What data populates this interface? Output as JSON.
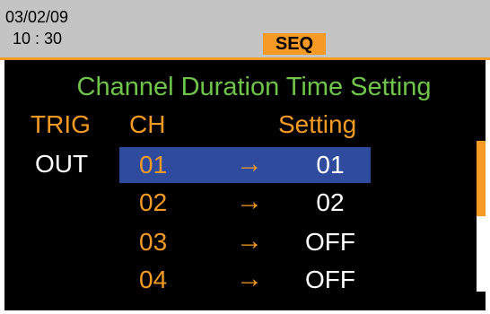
{
  "status": {
    "date": "03/02/09",
    "time": "10 : 30",
    "mode": "SEQ"
  },
  "panel": {
    "title": "Channel Duration Time Setting",
    "headers": {
      "trig": "TRIG",
      "ch": "CH",
      "setting": "Setting"
    },
    "trig_value": "OUT",
    "rows": [
      {
        "ch": "01",
        "arrow": "→",
        "value": "01",
        "selected": true
      },
      {
        "ch": "02",
        "arrow": "→",
        "value": "02",
        "selected": false
      },
      {
        "ch": "03",
        "arrow": "→",
        "value": "OFF",
        "selected": false
      },
      {
        "ch": "04",
        "arrow": "→",
        "value": "OFF",
        "selected": false
      }
    ]
  },
  "scrollbar": {
    "position_fraction": 0.0,
    "visible_fraction": 0.5
  },
  "colors": {
    "accent": "#f59a24",
    "title_green": "#6fc44a",
    "selection": "#2e4b9e",
    "status_bar": "#c4c4c4",
    "screen_bg": "#000000",
    "value_text": "#ffffff"
  }
}
